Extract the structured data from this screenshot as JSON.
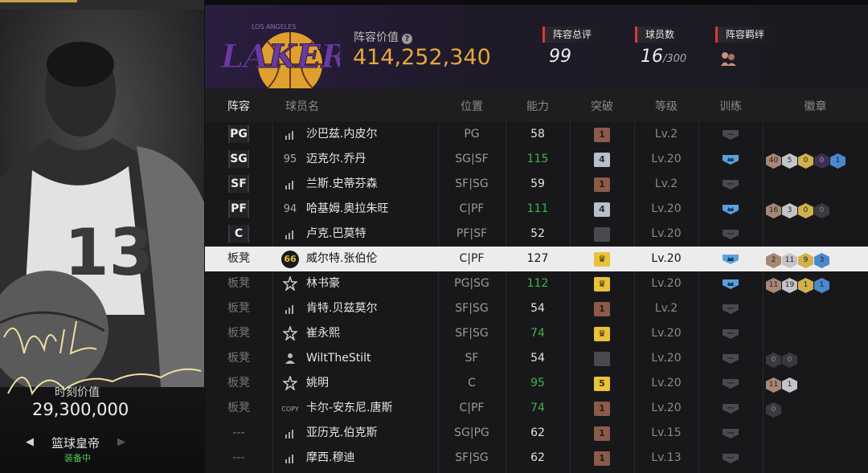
{
  "player_card": {
    "value_label": "时刻价值",
    "value": "29,300,000",
    "name": "篮球皇帝",
    "status": "装备中",
    "jersey_number": "13",
    "signature": "Wilt Chamberlain"
  },
  "header": {
    "team_logo_text": "LAKERS",
    "team_logo_subtext": "LOS ANGELES",
    "lineup_value_label": "阵容价值",
    "lineup_value": "414,252,340",
    "rating_label": "阵容总评",
    "rating_value": "99",
    "count_label": "球员数",
    "count_value": "16",
    "count_max": "/300",
    "bond_label": "阵容羁绊"
  },
  "table": {
    "headers": [
      "阵容",
      "球员名",
      "位置",
      "能力",
      "突破",
      "等级",
      "训练",
      "徽章"
    ],
    "rows": [
      {
        "slot": "PG",
        "icon": "bars",
        "name": "沙巴兹.内皮尔",
        "role": "PG",
        "ability": "58",
        "brk": "1",
        "brk_tier": "t1",
        "level": "Lv.2",
        "train": "off",
        "badges": []
      },
      {
        "slot": "SG",
        "icon": "95",
        "name": "迈克尔.乔丹",
        "role": "SG|SF",
        "ability": "115",
        "brk": "4",
        "brk_tier": "t4",
        "level": "Lv.20",
        "train": "on",
        "badges": [
          [
            "40",
            "h-br"
          ],
          [
            "5",
            "h-si"
          ],
          [
            "0",
            "h-go"
          ],
          [
            "0",
            "h-pu"
          ],
          [
            "1",
            "h-bl"
          ]
        ]
      },
      {
        "slot": "SF",
        "icon": "bars",
        "name": "兰斯.史蒂芬森",
        "role": "SF|SG",
        "ability": "59",
        "brk": "1",
        "brk_tier": "t1",
        "level": "Lv.2",
        "train": "off",
        "badges": []
      },
      {
        "slot": "PF",
        "icon": "94",
        "name": "哈基姆.奥拉朱旺",
        "role": "C|PF",
        "ability": "111",
        "brk": "4",
        "brk_tier": "t4",
        "level": "Lv.20",
        "train": "on",
        "badges": [
          [
            "16",
            "h-br"
          ],
          [
            "3",
            "h-si"
          ],
          [
            "0",
            "h-go"
          ],
          [
            "0",
            "h-dk"
          ]
        ]
      },
      {
        "slot": "C",
        "icon": "bars",
        "name": "卢克.巴莫特",
        "role": "PF|SF",
        "ability": "52",
        "brk": "",
        "brk_tier": "tn",
        "level": "Lv.20",
        "train": "off",
        "badges": []
      },
      {
        "slot": "板凳",
        "icon": "66",
        "name": "威尔特.张伯伦",
        "role": "C|PF",
        "ability": "127",
        "brk": "",
        "brk_tier": "tc",
        "level": "Lv.20",
        "train": "on",
        "badges": [
          [
            "2",
            "h-br"
          ],
          [
            "11",
            "h-si"
          ],
          [
            "9",
            "h-go"
          ],
          [
            "3",
            "h-bl"
          ]
        ]
      },
      {
        "slot": "板凳",
        "icon": "star",
        "name": "林书豪",
        "role": "PG|SG",
        "ability": "112",
        "brk": "",
        "brk_tier": "tc",
        "level": "Lv.20",
        "train": "on",
        "badges": [
          [
            "11",
            "h-br"
          ],
          [
            "19",
            "h-si"
          ],
          [
            "1",
            "h-go"
          ],
          [
            "1",
            "h-bl"
          ]
        ]
      },
      {
        "slot": "板凳",
        "icon": "bars",
        "name": "肯特.贝兹莫尔",
        "role": "SF|SG",
        "ability": "54",
        "brk": "1",
        "brk_tier": "t1",
        "level": "Lv.2",
        "train": "off",
        "badges": []
      },
      {
        "slot": "板凳",
        "icon": "star",
        "name": "崔永熙",
        "role": "SF|SG",
        "ability": "74",
        "brk": "",
        "brk_tier": "tc",
        "level": "Lv.20",
        "train": "off",
        "badges": []
      },
      {
        "slot": "板凳",
        "icon": "user",
        "name": "WiltTheStilt",
        "role": "SF",
        "ability": "54",
        "brk": "",
        "brk_tier": "tn",
        "level": "Lv.20",
        "train": "off",
        "badges": [
          [
            "0",
            "h-dk"
          ],
          [
            "0",
            "h-dk"
          ]
        ]
      },
      {
        "slot": "板凳",
        "icon": "star",
        "name": "姚明",
        "role": "C",
        "ability": "95",
        "brk": "5",
        "brk_tier": "t5",
        "level": "Lv.20",
        "train": "off",
        "badges": [
          [
            "11",
            "h-br"
          ],
          [
            "1",
            "h-si"
          ]
        ]
      },
      {
        "slot": "板凳",
        "icon": "COPY",
        "name": "卡尔-安东尼.唐斯",
        "role": "C|PF",
        "ability": "74",
        "brk": "1",
        "brk_tier": "t1",
        "level": "Lv.20",
        "train": "off",
        "badges": [
          [
            "0",
            "h-dk"
          ]
        ]
      },
      {
        "slot": "---",
        "icon": "bars",
        "name": "亚历克.伯克斯",
        "role": "SG|PG",
        "ability": "62",
        "brk": "1",
        "brk_tier": "t1",
        "level": "Lv.15",
        "train": "off",
        "badges": []
      },
      {
        "slot": "---",
        "icon": "bars",
        "name": "摩西.穆迪",
        "role": "SF|SG",
        "ability": "62",
        "brk": "1",
        "brk_tier": "t1",
        "level": "Lv.13",
        "train": "off",
        "badges": []
      }
    ],
    "green_ability": [
      "115",
      "111",
      "112",
      "74",
      "95"
    ]
  },
  "colors": {
    "accent_gold": "#e7a73c",
    "tag_red": "#d73a3a",
    "green": "#3fb24a",
    "train_blue": "#5aa0e0"
  }
}
